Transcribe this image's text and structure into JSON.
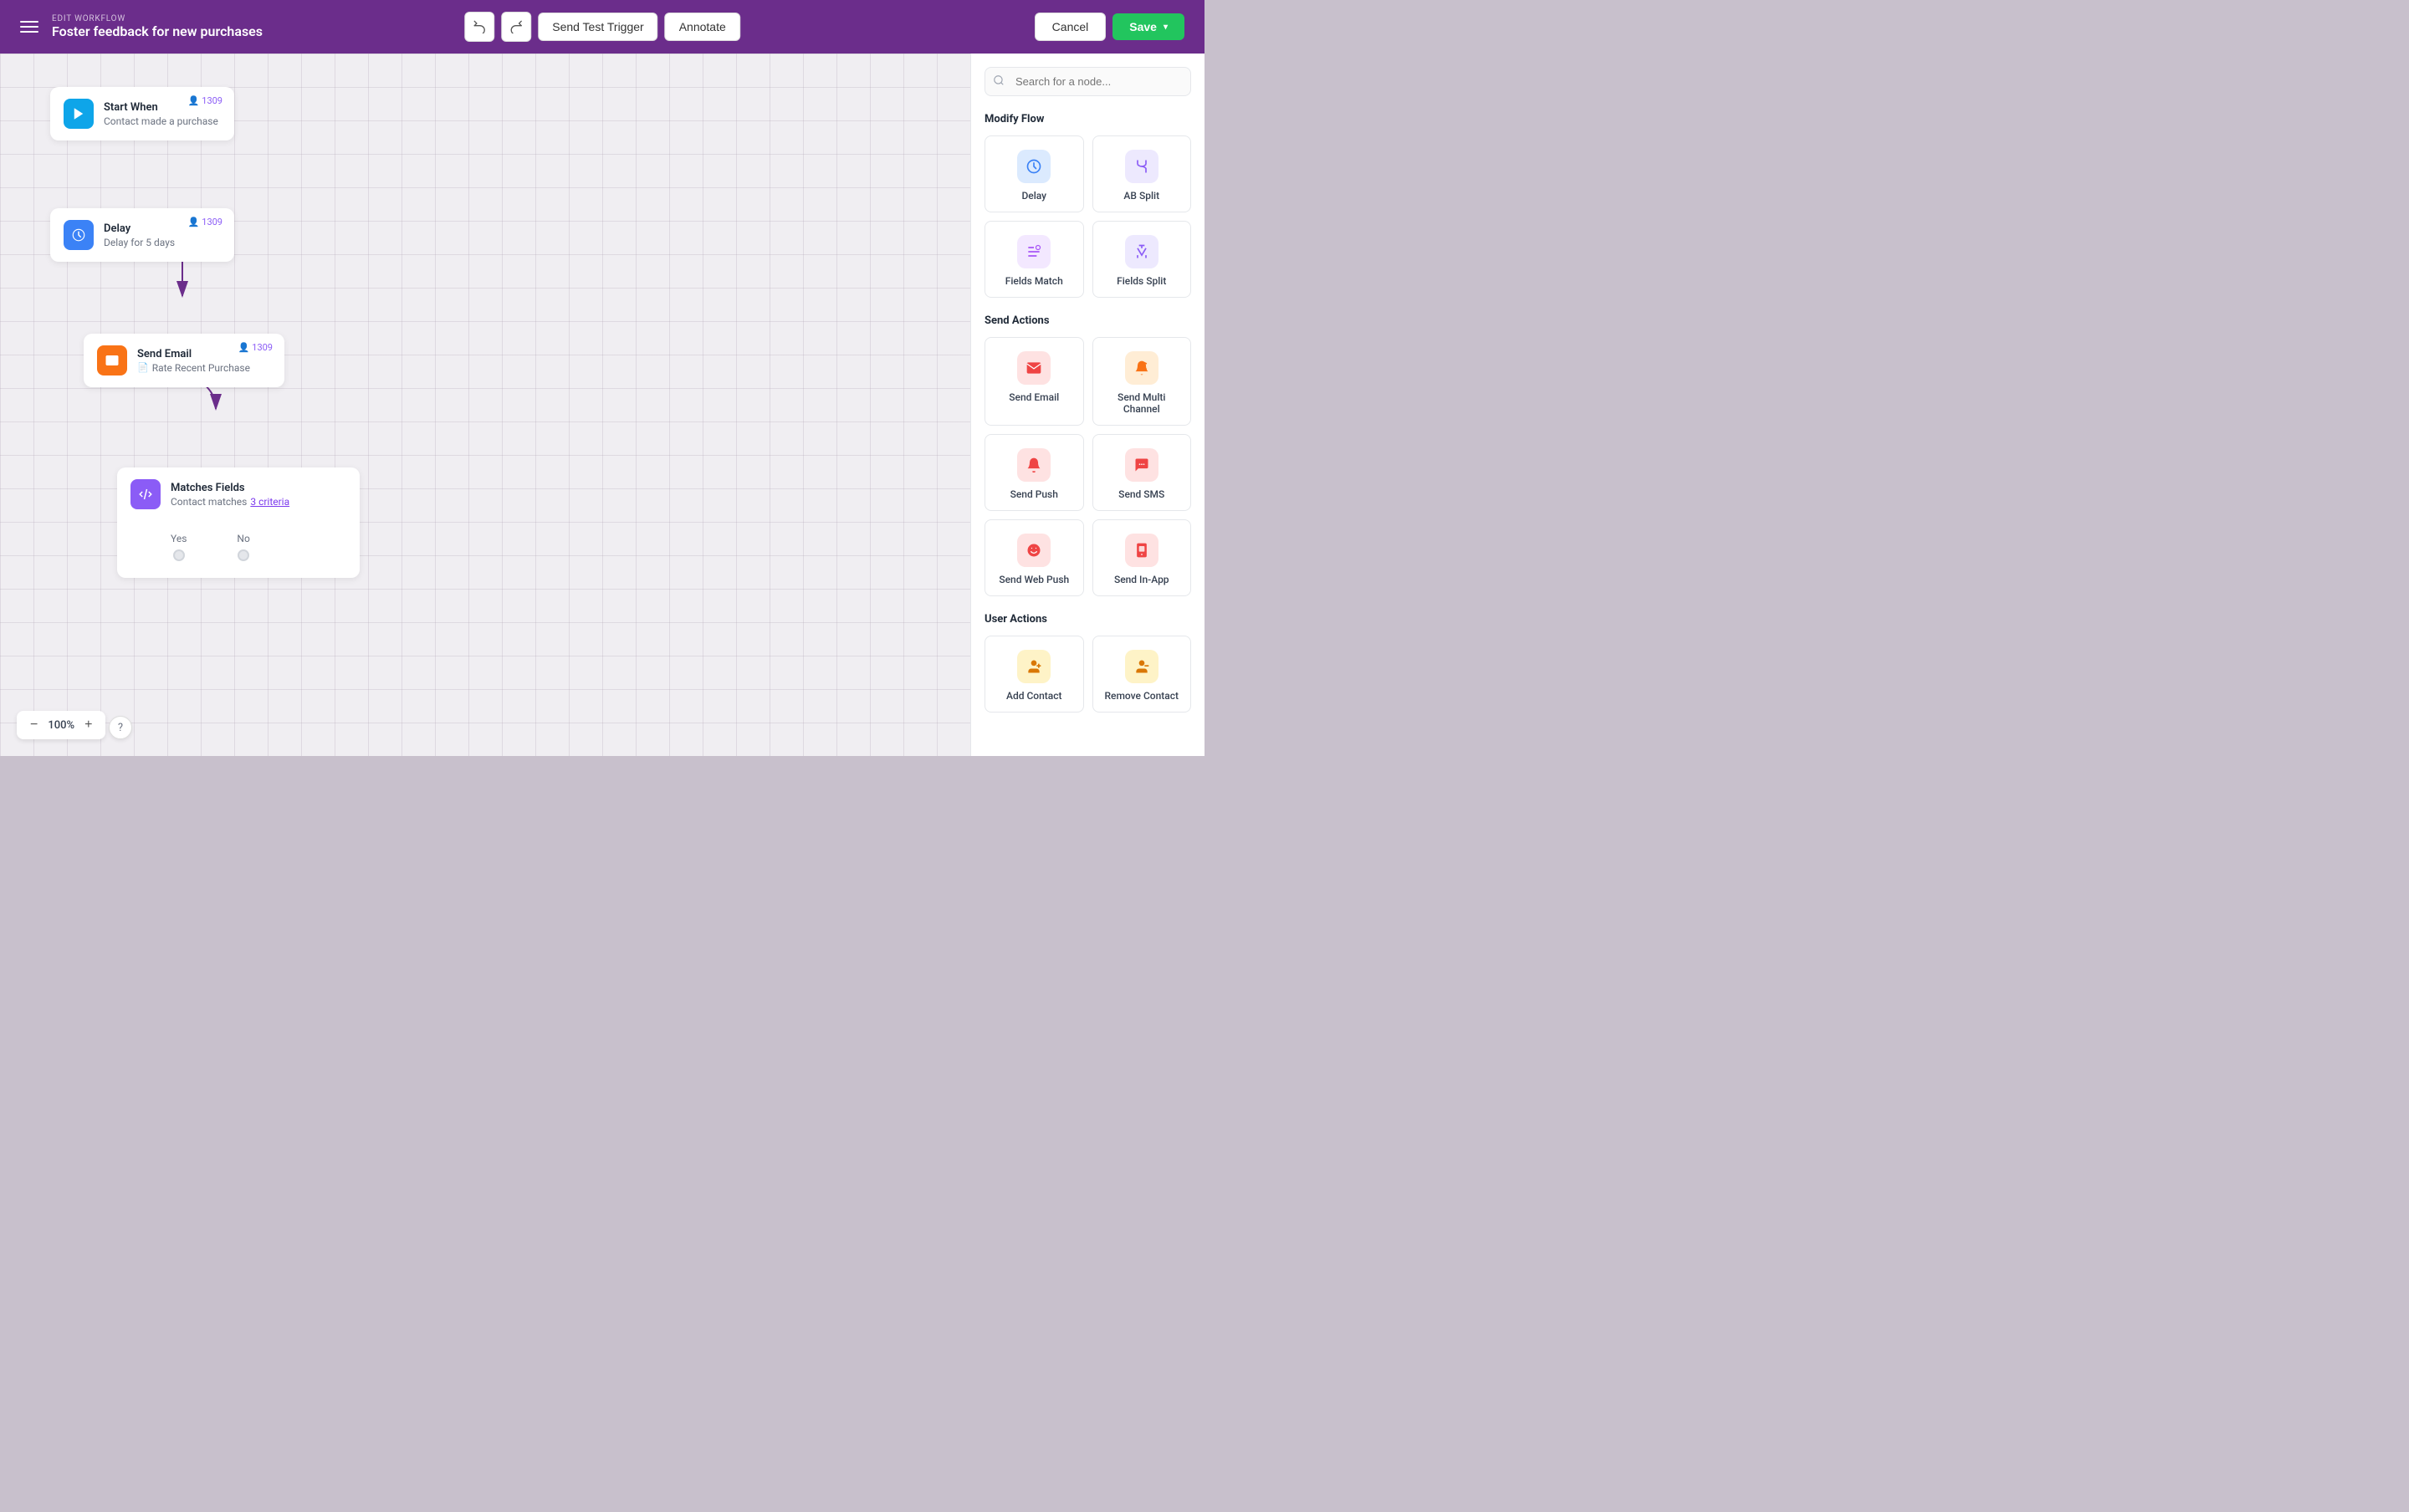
{
  "header": {
    "label": "EDIT WORKFLOW",
    "title": "Foster feedback for new purchases",
    "undo_label": "↺",
    "redo_label": "↻",
    "send_test_trigger": "Send Test Trigger",
    "annotate": "Annotate",
    "cancel": "Cancel",
    "save": "Save"
  },
  "canvas": {
    "zoom_level": "100%",
    "zoom_minus": "−",
    "zoom_plus": "+",
    "nodes": [
      {
        "id": "start",
        "title": "Start When",
        "subtitle": "Contact made a purchase",
        "count": "1309",
        "icon_type": "teal",
        "icon": "▶"
      },
      {
        "id": "delay",
        "title": "Delay",
        "subtitle": "Delay for 5 days",
        "count": "1309",
        "icon_type": "blue",
        "icon": "⏱"
      },
      {
        "id": "send_email",
        "title": "Send Email",
        "subtitle": "Rate Recent Purchase",
        "count": "1309",
        "icon_type": "orange",
        "icon": "✉"
      },
      {
        "id": "matches_fields",
        "title": "Matches Fields",
        "subtitle_text": "Contact matches",
        "subtitle_link": "3 criteria",
        "count": null,
        "icon_type": "purple",
        "icon": "⇄",
        "branches": [
          "Yes",
          "No"
        ]
      }
    ]
  },
  "right_panel": {
    "search_placeholder": "Search for a node...",
    "sections": [
      {
        "title": "Modify Flow",
        "nodes": [
          {
            "id": "delay",
            "label": "Delay",
            "icon": "⏱",
            "bg": "bg-blue",
            "color": "#3b82f6"
          },
          {
            "id": "ab_split",
            "label": "AB Split",
            "icon": "⇄",
            "bg": "bg-purple",
            "color": "#8b5cf6"
          },
          {
            "id": "fields_match",
            "label": "Fields Match",
            "icon": "◎",
            "bg": "bg-purple2",
            "color": "#a855f7"
          },
          {
            "id": "fields_split",
            "label": "Fields Split",
            "icon": "⑃",
            "bg": "bg-purple",
            "color": "#8b5cf6"
          }
        ]
      },
      {
        "title": "Send Actions",
        "nodes": [
          {
            "id": "send_email",
            "label": "Send Email",
            "icon": "✉",
            "bg": "bg-red",
            "color": "#ef4444"
          },
          {
            "id": "send_multi",
            "label": "Send Multi Channel",
            "icon": "📢",
            "bg": "bg-red",
            "color": "#f97316"
          },
          {
            "id": "send_push",
            "label": "Send Push",
            "icon": "🔔",
            "bg": "bg-red",
            "color": "#ef4444"
          },
          {
            "id": "send_sms",
            "label": "Send SMS",
            "icon": "💬",
            "bg": "bg-red",
            "color": "#ef4444"
          },
          {
            "id": "send_web_push",
            "label": "Send Web Push",
            "icon": "🌐",
            "bg": "bg-red",
            "color": "#ef4444"
          },
          {
            "id": "send_in_app",
            "label": "Send In-App",
            "icon": "📱",
            "bg": "bg-red",
            "color": "#ef4444"
          }
        ]
      },
      {
        "title": "User Actions",
        "nodes": [
          {
            "id": "add_contact",
            "label": "Add Contact",
            "icon": "👤+",
            "bg": "bg-amber",
            "color": "#d97706"
          },
          {
            "id": "remove_contact",
            "label": "Remove Contact",
            "icon": "👤-",
            "bg": "bg-amber",
            "color": "#d97706"
          }
        ]
      }
    ]
  }
}
